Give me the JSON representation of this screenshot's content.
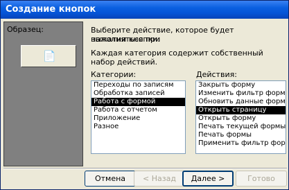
{
  "window": {
    "title": "Создание кнопок"
  },
  "preview": {
    "label": "Образец:",
    "icon": "form-icon"
  },
  "description": {
    "line1": "Выберите действие, которое будет выполняться при",
    "line2": "нажатии кнопки.",
    "line3": "Каждая категория содержит собственный набор действий."
  },
  "categories": {
    "label": "Категории:",
    "items": [
      "Переходы по записям",
      "Обработка записей",
      "Работа с формой",
      "Работа с отчетом",
      "Приложение",
      "Разное"
    ],
    "selected": "Работа с формой"
  },
  "actions": {
    "label": "Действия:",
    "items": [
      "Закрыть форму",
      "Изменить фильтр формы",
      "Обновить данные формы",
      "Открыть страницу",
      "Открыть форму",
      "Печать текущей формы",
      "Печать формы",
      "Применить фильтр формы"
    ],
    "selected": "Открыть страницу"
  },
  "buttons": {
    "cancel": "Отмена",
    "back": "< Назад",
    "next": "Далее >",
    "finish": "Готово"
  }
}
